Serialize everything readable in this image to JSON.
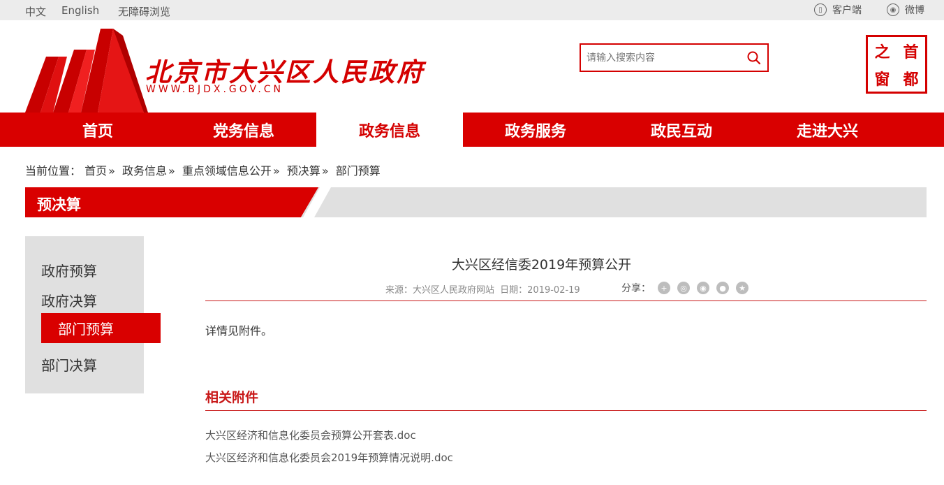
{
  "topbar": {
    "lang_cn": "中文",
    "lang_en": "English",
    "accessibility": "无障碍浏览",
    "client": "客户端",
    "weibo": "微博"
  },
  "header": {
    "site_title": "北京市大兴区人民政府",
    "site_url": "WWW.BJDX.GOV.CN",
    "search_placeholder": "请输入搜索内容",
    "seal_chars": [
      "之",
      "首",
      "窗",
      "都"
    ]
  },
  "nav": {
    "items": [
      {
        "label": "首页"
      },
      {
        "label": "党务信息"
      },
      {
        "label": "政务信息"
      },
      {
        "label": "政务服务"
      },
      {
        "label": "政民互动"
      },
      {
        "label": "走进大兴"
      }
    ],
    "active_index": 2
  },
  "breadcrumb": {
    "prefix": "当前位置：",
    "items": [
      "首页",
      "政务信息",
      "重点领域信息公开",
      "预决算",
      "部门预算"
    ],
    "separator": "»"
  },
  "section": {
    "title": "预决算"
  },
  "sidebar": {
    "items": [
      {
        "label": "政府预算"
      },
      {
        "label": "政府决算"
      },
      {
        "label": "部门预算"
      },
      {
        "label": "部门决算"
      }
    ],
    "active_index": 2
  },
  "article": {
    "title": "大兴区经信委2019年预算公开",
    "source": "来源：大兴区人民政府网站",
    "date": "日期：2019-02-19",
    "share_label": "分享：",
    "body": "详情见附件。",
    "attachments_title": "相关附件",
    "attachments": [
      "大兴区经济和信息化委员会预算公开套表.doc",
      "大兴区经济和信息化委员会2019年预算情况说明.doc"
    ]
  },
  "colors": {
    "brand_red": "#d90000",
    "rule_red": "#c81818",
    "panel_gray": "#e0e0e0"
  }
}
